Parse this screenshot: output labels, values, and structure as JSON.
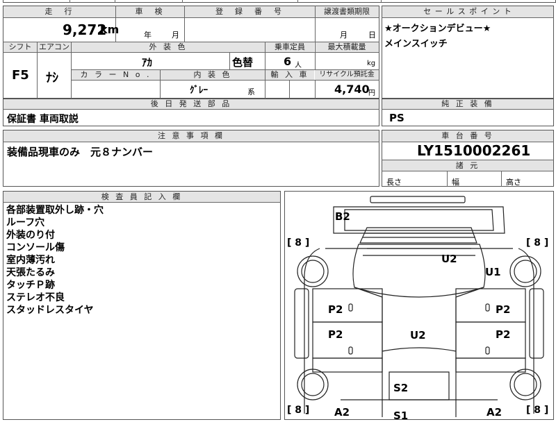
{
  "headers": {
    "mileage": "走　行",
    "inspection": "車　検",
    "registration": "登　録　番　号",
    "transfer_deadline": "譲渡書類期限",
    "sales_point": "セ ー ル ス ポ イ ン ト",
    "shift": "シフト",
    "aircon": "エアコン",
    "exterior_color": "外 装 色",
    "capacity": "乗車定員",
    "max_load": "最大積載量",
    "color_no": "カ ラ ー N o .",
    "interior_color": "内 装 色",
    "import": "輸 入 車",
    "recycle_deposit": "リサイクル預託金",
    "later_parts": "後 日 発 送 部 品",
    "equipment": "純 正 装 備",
    "notice": "注 意 事 項 欄",
    "chassis_no": "車 台 番 号",
    "dimensions": "諸 元",
    "inspector_notes": "検 査 員 記 入 欄"
  },
  "values": {
    "mileage": "9,272",
    "mileage_unit": "km",
    "inspection_year": "年",
    "inspection_month": "月",
    "transfer_month": "月",
    "transfer_day": "日",
    "shift": "F5",
    "aircon": "ﾅｼ",
    "exterior_color": "ｱｶ",
    "color_change": "色替",
    "capacity": "6",
    "capacity_unit": "人",
    "max_load_unit": "kg",
    "interior_color": "ｸﾞﾚｰ",
    "interior_suffix": "系",
    "recycle_amount": "4,740",
    "recycle_unit": "円",
    "later_parts": "保証書 車両取説",
    "equipment": "PS",
    "notice": "装備品現車のみ　元８ナンバー",
    "chassis_no": "LY1510002261",
    "length_label": "長さ",
    "width_label": "幅",
    "height_label": "高さ"
  },
  "sales_points": [
    "★オークションデビュー★",
    "メインスイッチ"
  ],
  "inspector_notes": [
    "各部装置取外し跡・穴",
    "ルーフ穴",
    "外装のり付",
    "コンソール傷",
    "室内薄汚れ",
    "天張たるみ",
    "タッチＰ跡",
    "ステレオ不良",
    "スタッドレスタイヤ"
  ],
  "diagram": {
    "tread_labels": [
      "[ 8 ]",
      "[ 8 ]",
      "[ 8 ]",
      "[ 8 ]"
    ],
    "marks": [
      "B2",
      "U2",
      "U1",
      "P2",
      "P2",
      "P2",
      "U2",
      "P2",
      "S2",
      "S1",
      "A2",
      "A2"
    ]
  }
}
